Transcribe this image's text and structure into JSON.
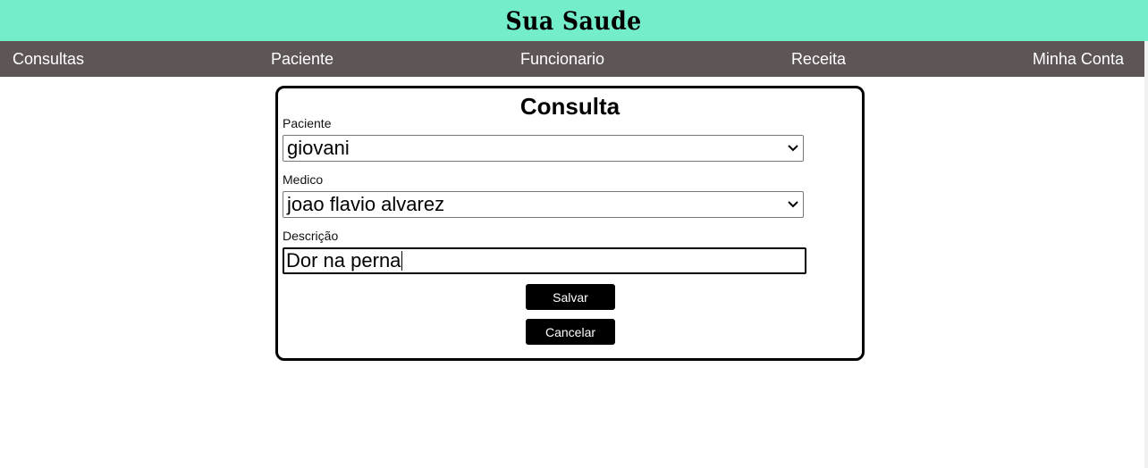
{
  "header": {
    "brand": "Sua Saude"
  },
  "nav": {
    "items": [
      {
        "label": "Consultas"
      },
      {
        "label": "Paciente"
      },
      {
        "label": "Funcionario"
      },
      {
        "label": "Receita"
      },
      {
        "label": "Minha Conta"
      }
    ]
  },
  "form": {
    "title": "Consulta",
    "paciente": {
      "label": "Paciente",
      "value": "giovani"
    },
    "medico": {
      "label": "Medico",
      "value": "joao flavio alvarez"
    },
    "descricao": {
      "label": "Descrição",
      "value": "Dor na perna"
    },
    "save_label": "Salvar",
    "cancel_label": "Cancelar"
  },
  "colors": {
    "header_bg": "#74edcb",
    "nav_bg": "#5e5556",
    "button_bg": "#000000"
  },
  "icons": {
    "select_arrow": "chevron-down-icon"
  }
}
